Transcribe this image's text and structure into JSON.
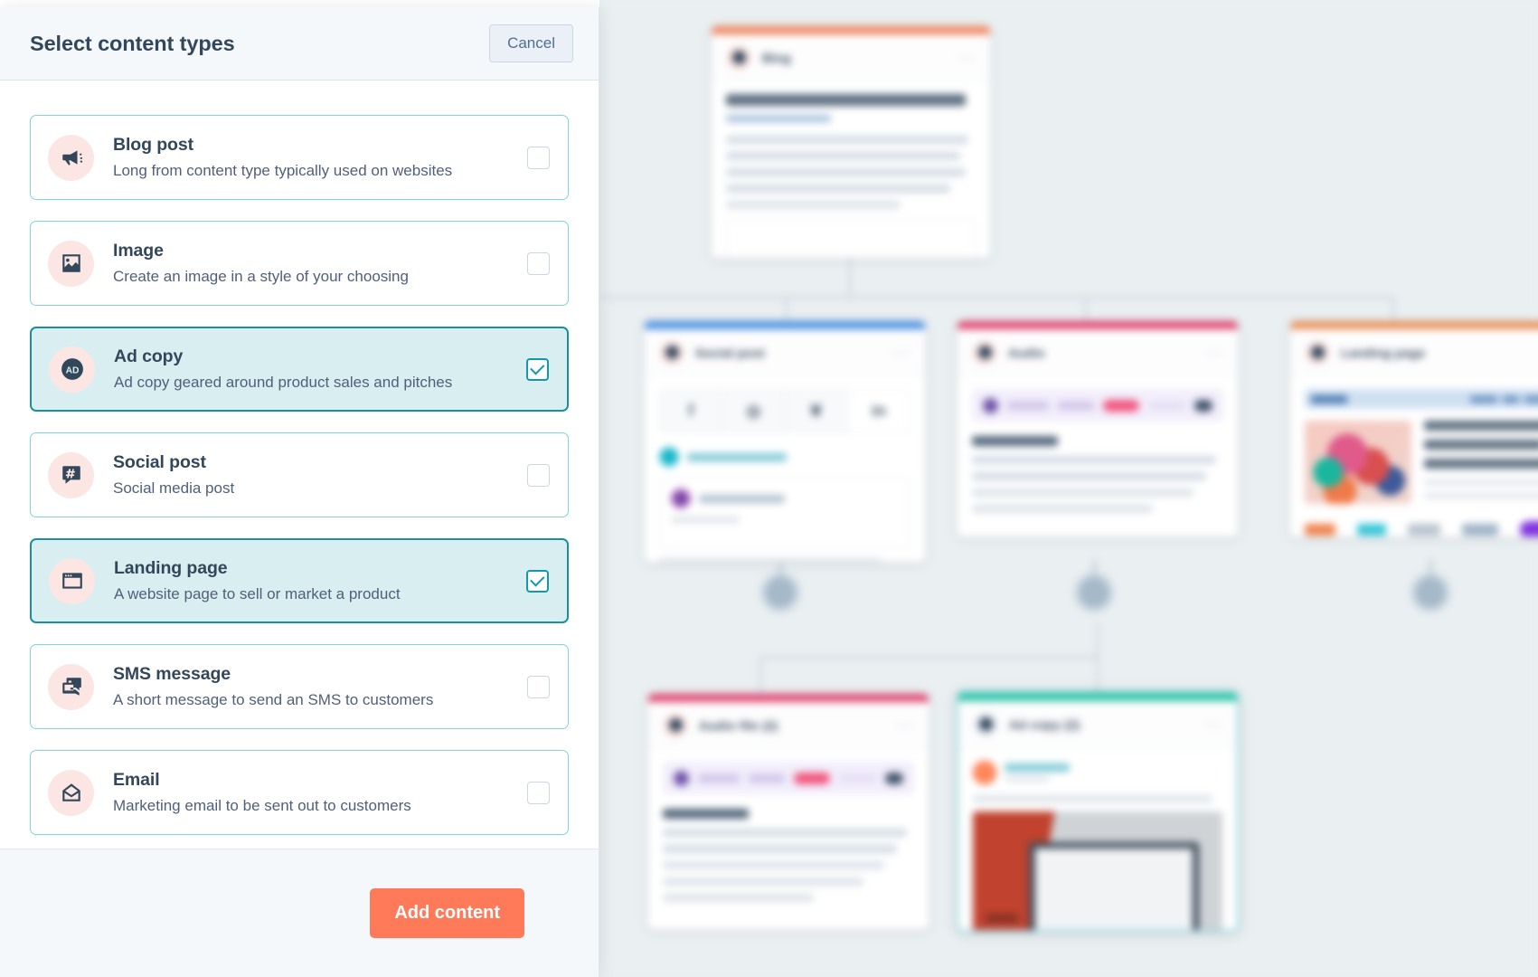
{
  "panel": {
    "title": "Select content types",
    "cancel_label": "Cancel",
    "add_label": "Add content",
    "accent_orange": "#ff7a59",
    "accent_teal": "#0e9aae",
    "options": [
      {
        "id": "blog-post",
        "title": "Blog post",
        "description": "Long from content type typically used on websites",
        "icon": "megaphone-icon",
        "selected": false
      },
      {
        "id": "image",
        "title": "Image",
        "description": "Create an image in a style of your choosing",
        "icon": "image-icon",
        "selected": false
      },
      {
        "id": "ad-copy",
        "title": "Ad copy",
        "description": "Ad copy geared around product sales and pitches",
        "icon": "ad-badge-icon",
        "selected": true
      },
      {
        "id": "social-post",
        "title": "Social post",
        "description": "Social media post",
        "icon": "hashtag-bubble-icon",
        "selected": false
      },
      {
        "id": "landing-page",
        "title": "Landing page",
        "description": "A website page to sell or market a product",
        "icon": "browser-window-icon",
        "selected": false
      },
      {
        "id": "sms-message",
        "title": "SMS message",
        "description": "A short message to send an SMS to customers",
        "icon": "chat-bubbles-icon",
        "selected": false
      },
      {
        "id": "email",
        "title": "Email",
        "description": "Marketing email to be sent out to customers",
        "icon": "envelope-icon",
        "selected": false
      }
    ]
  },
  "canvas": {
    "cards": [
      {
        "id": "blog",
        "label": "Blog",
        "bar_color": "#f0845c",
        "selected": false
      },
      {
        "id": "social-post",
        "label": "Social post",
        "bar_color": "#4a90e2",
        "selected": false
      },
      {
        "id": "audio",
        "label": "Audio",
        "bar_color": "#e0456e",
        "selected": false
      },
      {
        "id": "landing-page",
        "label": "Landing page",
        "bar_color": "#e89158",
        "selected": false
      },
      {
        "id": "audio-file-2",
        "label": "Audio file (2)",
        "bar_color": "#e0456e",
        "selected": false
      },
      {
        "id": "ad-copy-2",
        "label": "Ad copy (2)",
        "bar_color": "#2ec4a6",
        "selected": true
      }
    ],
    "card_menu_glyph": "···",
    "social_icons": [
      "f",
      "◎",
      "❦",
      "in"
    ]
  }
}
